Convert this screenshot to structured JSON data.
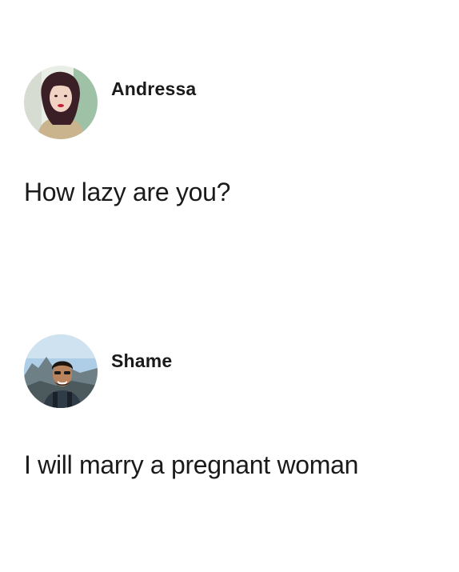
{
  "posts": [
    {
      "author": "Andressa",
      "avatar_icon": "profile-photo-woman",
      "message": "How lazy are you?"
    },
    {
      "author": "Shame",
      "avatar_icon": "profile-photo-man-mountains",
      "message": "I will marry a pregnant woman"
    }
  ]
}
